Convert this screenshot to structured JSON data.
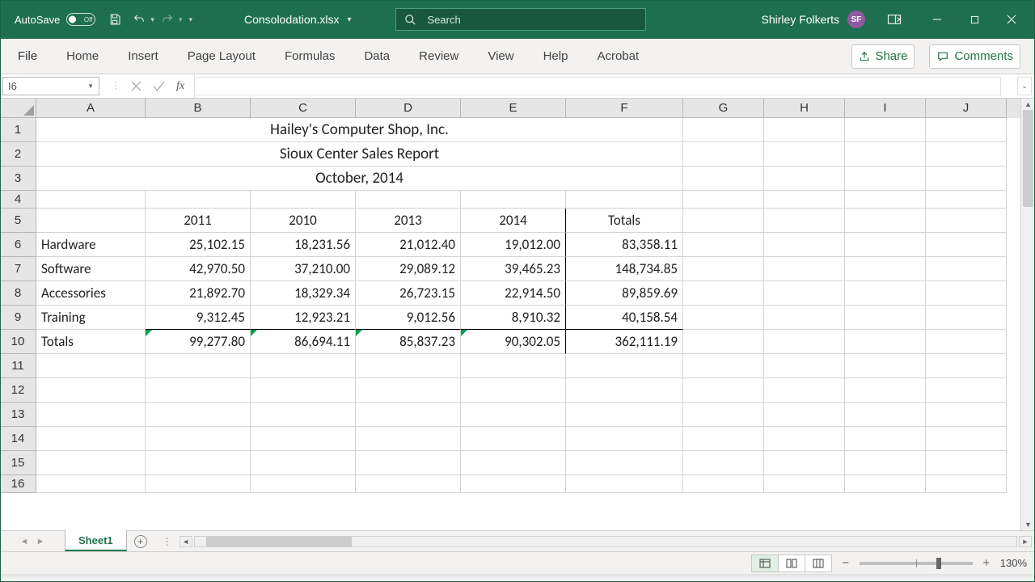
{
  "title_bar": {
    "autosave_label": "AutoSave",
    "autosave_state": "Off",
    "filename": "Consolodation.xlsx",
    "search_placeholder": "Search",
    "user_name": "Shirley Folkerts",
    "user_initials": "SF"
  },
  "ribbon": {
    "tabs": [
      "File",
      "Home",
      "Insert",
      "Page Layout",
      "Formulas",
      "Data",
      "Review",
      "View",
      "Help",
      "Acrobat"
    ],
    "share": "Share",
    "comments": "Comments"
  },
  "formula_bar": {
    "name_box": "I6",
    "fx": "fx",
    "value": ""
  },
  "columns": [
    "A",
    "B",
    "C",
    "D",
    "E",
    "F",
    "G",
    "H",
    "I",
    "J"
  ],
  "row_numbers": [
    "1",
    "2",
    "3",
    "4",
    "5",
    "6",
    "7",
    "8",
    "9",
    "10",
    "11",
    "12",
    "13",
    "14",
    "15",
    "16"
  ],
  "merged": {
    "r1": "Hailey's Computer Shop, Inc.",
    "r2": "Sioux Center Sales Report",
    "r3": "October, 2014"
  },
  "headers": {
    "b": "2011",
    "c": "2010",
    "d": "2013",
    "e": "2014",
    "f": "Totals"
  },
  "rows": [
    {
      "a": "Hardware",
      "b": "25,102.15",
      "c": "18,231.56",
      "d": "21,012.40",
      "e": "19,012.00",
      "f": "83,358.11"
    },
    {
      "a": "Software",
      "b": "42,970.50",
      "c": "37,210.00",
      "d": "29,089.12",
      "e": "39,465.23",
      "f": "148,734.85"
    },
    {
      "a": "Accessories",
      "b": "21,892.70",
      "c": "18,329.34",
      "d": "26,723.15",
      "e": "22,914.50",
      "f": "89,859.69"
    },
    {
      "a": "Training",
      "b": "9,312.45",
      "c": "12,923.21",
      "d": "9,012.56",
      "e": "8,910.32",
      "f": "40,158.54"
    },
    {
      "a": "Totals",
      "b": "99,277.80",
      "c": "86,694.11",
      "d": "85,837.23",
      "e": "90,302.05",
      "f": "362,111.19"
    }
  ],
  "sheet_tab": "Sheet1",
  "status": {
    "zoom": "130%"
  },
  "chart_data": {
    "type": "table",
    "title": "Hailey's Computer Shop, Inc. — Sioux Center Sales Report — October, 2014",
    "columns": [
      "2011",
      "2010",
      "2013",
      "2014",
      "Totals"
    ],
    "rows": [
      {
        "category": "Hardware",
        "2011": 25102.15,
        "2010": 18231.56,
        "2013": 21012.4,
        "2014": 19012.0,
        "Totals": 83358.11
      },
      {
        "category": "Software",
        "2011": 42970.5,
        "2010": 37210.0,
        "2013": 29089.12,
        "2014": 39465.23,
        "Totals": 148734.85
      },
      {
        "category": "Accessories",
        "2011": 21892.7,
        "2010": 18329.34,
        "2013": 26723.15,
        "2014": 22914.5,
        "Totals": 89859.69
      },
      {
        "category": "Training",
        "2011": 9312.45,
        "2010": 12923.21,
        "2013": 9012.56,
        "2014": 8910.32,
        "Totals": 40158.54
      },
      {
        "category": "Totals",
        "2011": 99277.8,
        "2010": 86694.11,
        "2013": 85837.23,
        "2014": 90302.05,
        "Totals": 362111.19
      }
    ]
  }
}
